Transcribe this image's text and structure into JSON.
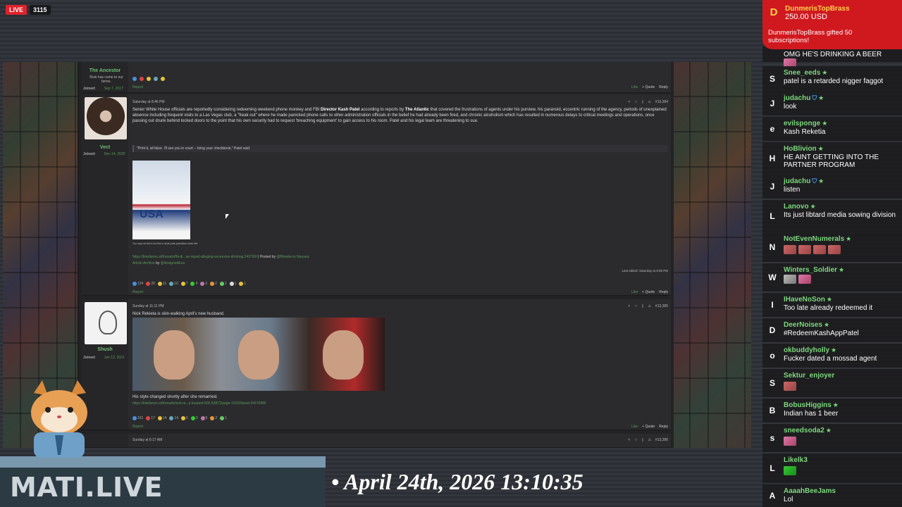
{
  "stream": {
    "live_label": "LIVE",
    "viewer_count": "3115",
    "brand": "MATI.LIVE",
    "clock": "• April 24th, 2026 13:10:35"
  },
  "donation": {
    "avatar_letter": "D",
    "name": "DunmerisTopBrass",
    "amount": "250.00 USD",
    "message": "DunmerisTopBrass gifted 50 subscriptions!"
  },
  "forum": {
    "prev_post": {
      "username": "The Ancestor",
      "user_title": "Ruin has come to our farms.",
      "joined_label": "Joined:",
      "joined_date": "Sep 7, 2017",
      "report": "Report",
      "like": "Like",
      "quote": "+ Quote",
      "reply": "Reply"
    },
    "post1": {
      "date": "Saturday at 8:46 PM",
      "number": "#13,284",
      "username": "Vect",
      "joined_label": "Joined:",
      "joined_date": "Dec 14, 2020",
      "body_lead": "Senior White House officials are reportedly considering redeeming weekend phone monkey and FBI",
      "body_bold1": "Director Kash Patel",
      "body_mid": "according to reports by",
      "body_bold2": "The Atlantic",
      "body_rest": "that covered the frustrations of agents under his purview. his paranoid, eccentric running of the agency, periods of unexplained absence including frequent visits to a Las Vegas club, a \"freak out\" where he made panicked phone calls to other administration officials in the belief he had already been fired, and chronic alcoholism which has resulted in numerous delays to critical meetings and operations, once passing out drunk behind locked doors to the point that his own security had to request 'breaching equipment' to gain access to his room. Patel and his legal team are threatening to sue.",
      "quote": "\"Print it, all false. I'll see you in court -- bring your checkbook,\" Patel said.",
      "image_text": "USA",
      "image_caption": "You may not like it but this is what peak patriotism looks like",
      "source_link": "https://kiwifarms.st/threads/fbi-di...se-report-alleging-excessive-drinking.243790/",
      "posted_by_label": "| Posted by",
      "posted_by": "@Blewberry Nausea",
      "archive_label": "Article Archive",
      "by_label": "by",
      "assigned": "@AssignedEva",
      "last_edited": "Last edited: Saturday at 9:59 PM",
      "reactions": [
        "124",
        "20",
        "11",
        "10",
        "7",
        "4",
        "3",
        "2",
        "1",
        "1",
        "1"
      ],
      "report": "Report",
      "like": "Like",
      "quote_btn": "+ Quote",
      "reply": "Reply"
    },
    "post2": {
      "date": "Sunday at 11:11 PM",
      "number": "#13,285",
      "username": "Shush",
      "joined_label": "Joined:",
      "joined_date": "Jan 12, 2021",
      "body": "Nick Rekieta is skin-walking April's new husband.",
      "caption": "His style changed shortly after she remarried.",
      "link": "https://kiwifarms.st/threads/nick-re...y-leopard-835.53871/page-11630#post-24276986",
      "reactions": [
        "161",
        "17",
        "14",
        "14",
        "5",
        "3",
        "5",
        "2",
        "1"
      ],
      "report": "Report",
      "like": "Like",
      "quote_btn": "+ Quote",
      "reply": "Reply"
    },
    "post3": {
      "date": "Sunday at 6:17 AM",
      "number": "#13,286"
    }
  },
  "chat": [
    {
      "letter": "",
      "name": "",
      "badge": "",
      "message": "OMG HE'S DRINKING A BEER",
      "emotes": [
        "pink"
      ]
    },
    {
      "letter": "S",
      "name": "Snee_eeds",
      "badge": "star",
      "message": "patel is a retarded nigger faggot",
      "emotes": []
    },
    {
      "letter": "J",
      "name": "judachu",
      "badge": "shield-star",
      "message": "look",
      "emotes": []
    },
    {
      "letter": "e",
      "name": "evilsponge",
      "badge": "star",
      "message": "Kash Reketia",
      "emotes": []
    },
    {
      "letter": "H",
      "name": "HoBlivion",
      "badge": "star",
      "message": "HE AINT GETTING INTO THE PARTNER PROGRAM",
      "emotes": []
    },
    {
      "letter": "J",
      "name": "judachu",
      "badge": "shield-star",
      "message": "listen",
      "emotes": []
    },
    {
      "letter": "L",
      "name": "Lanovo",
      "badge": "star",
      "message": "Its just libtard media sowing division",
      "emotes": []
    },
    {
      "letter": "N",
      "name": "NotEvenNumerals",
      "badge": "star",
      "message": "",
      "emotes": [
        "red",
        "red",
        "red",
        "red"
      ]
    },
    {
      "letter": "W",
      "name": "Winters_Soldier",
      "badge": "star",
      "message": "",
      "emotes": [
        "grey",
        "pink"
      ]
    },
    {
      "letter": "I",
      "name": "IHaveNoSon",
      "badge": "star",
      "message": "Too late already redeemed it",
      "emotes": []
    },
    {
      "letter": "D",
      "name": "DeerNoises",
      "badge": "star",
      "message": "#RedeemKashAppPatel",
      "emotes": []
    },
    {
      "letter": "o",
      "name": "okbuddyholly",
      "badge": "star",
      "message": "Fucker dated a mossad agent",
      "emotes": []
    },
    {
      "letter": "S",
      "name": "Sektur_enjoyer",
      "badge": "",
      "message": "",
      "emotes": [
        "red"
      ]
    },
    {
      "letter": "B",
      "name": "BobusHiggins",
      "badge": "star",
      "message": "Indian has 1 beer",
      "emotes": []
    },
    {
      "letter": "s",
      "name": "sneedsoda2",
      "badge": "star",
      "message": "",
      "emotes": [
        "pink"
      ]
    },
    {
      "letter": "L",
      "name": "Likelk3",
      "badge": "",
      "message": "",
      "emotes": [
        "green"
      ]
    },
    {
      "letter": "A",
      "name": "AaaahBeeJams",
      "badge": "",
      "message": "Lol",
      "emotes": []
    }
  ]
}
